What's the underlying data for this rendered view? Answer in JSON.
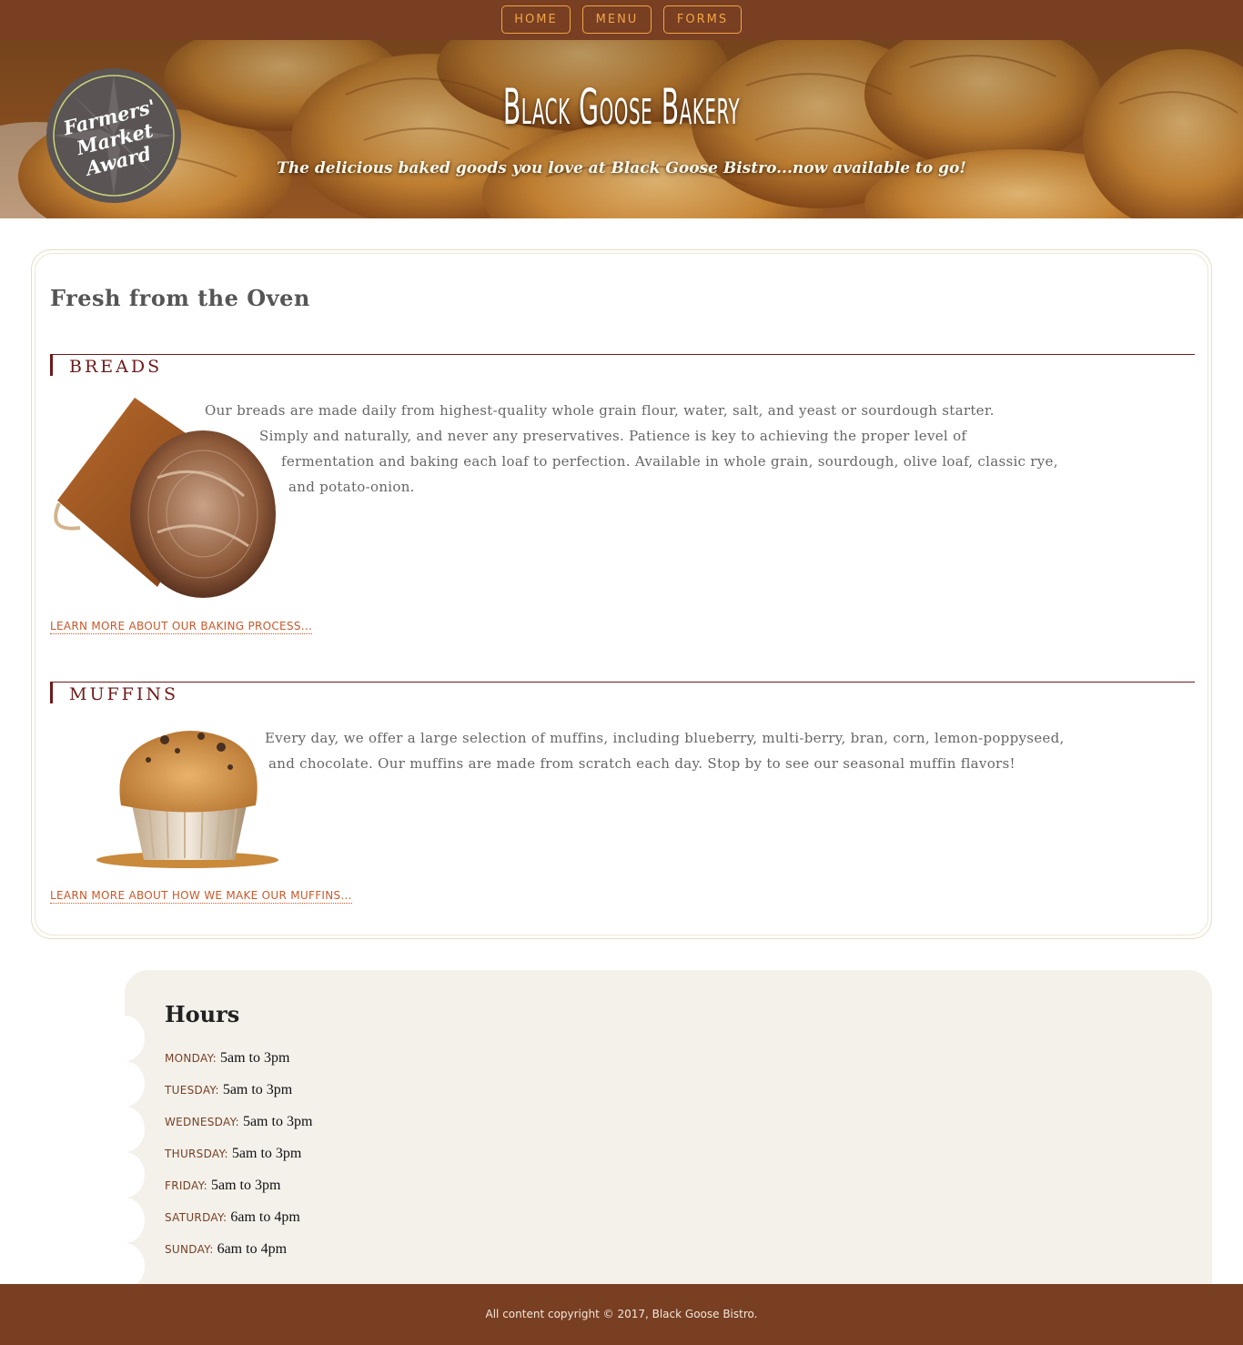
{
  "nav": {
    "items": [
      {
        "label": "HOME"
      },
      {
        "label": "MENU"
      },
      {
        "label": "FORMS"
      }
    ]
  },
  "hero": {
    "title": "Black Goose Bakery",
    "tagline": "The delicious baked goods you love at Black Goose Bistro...now available to go!",
    "award_badge_text": "Farmers' Market Award"
  },
  "products": {
    "title": "Fresh from the Oven",
    "breads": {
      "heading": "BREADS",
      "lines": [
        "Our breads are made daily from highest-quality whole grain flour, water, salt, and yeast or sourdough starter.",
        "Simply and naturally, and never any preservatives. Patience is key to achieving the proper level of",
        "fermentation and baking each loaf to perfection. Available in whole grain, sourdough, olive loaf, classic rye,",
        "and potato-onion."
      ],
      "link": "LEARN MORE ABOUT OUR BAKING PROCESS..."
    },
    "muffins": {
      "heading": "MUFFINS",
      "lines": [
        "Every day, we offer a large selection of muffins, including blueberry, multi-berry, bran, corn, lemon-poppyseed,",
        "and chocolate. Our muffins are made from scratch each day. Stop by to see our seasonal muffin flavors!"
      ],
      "link": "LEARN MORE ABOUT HOW WE MAKE OUR MUFFINS..."
    }
  },
  "hours": {
    "title": "Hours",
    "days": [
      {
        "day": "MONDAY:",
        "time": "5am to 3pm"
      },
      {
        "day": "TUESDAY:",
        "time": "5am to 3pm"
      },
      {
        "day": "WEDNESDAY:",
        "time": "5am to 3pm"
      },
      {
        "day": "THURSDAY:",
        "time": "5am to 3pm"
      },
      {
        "day": "FRIDAY:",
        "time": "5am to 3pm"
      },
      {
        "day": "SATURDAY:",
        "time": "6am to 4pm"
      },
      {
        "day": "SUNDAY:",
        "time": "6am to 4pm"
      }
    ]
  },
  "footer": {
    "copyright": "All content copyright © 2017, Black Goose Bistro."
  },
  "colors": {
    "brand_brown": "#783f23",
    "nav_accent": "#f1a544",
    "heading_red": "#6e1a1a",
    "link_orange": "#c8592b",
    "hours_bg": "#f4f1eb"
  }
}
